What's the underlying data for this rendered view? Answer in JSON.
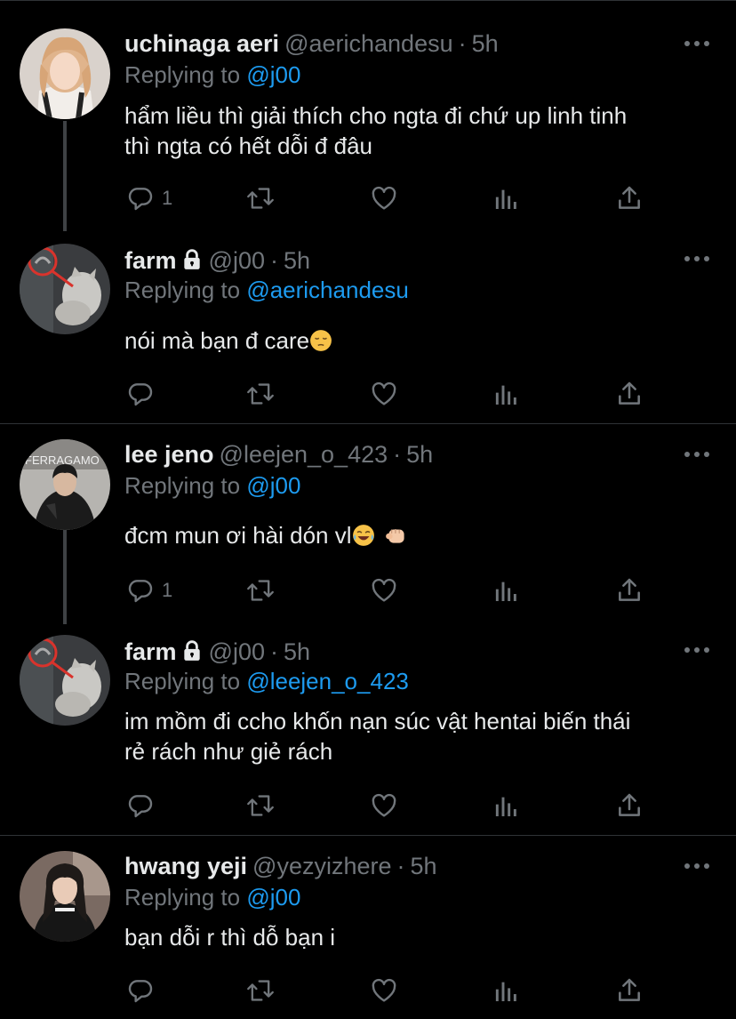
{
  "tweets": [
    {
      "name": "uchinaga aeri",
      "handle": "@aerichandesu",
      "dot": "·",
      "time": "5h",
      "locked": false,
      "replying_prefix": "Replying to ",
      "replying_to": "@j00",
      "text_lines": [
        "hẩm liều thì giải thích cho ngta đi chứ up linh tinh",
        "thì ngta có hết dỗi đ đâu"
      ],
      "reply_count": "1",
      "avatar": "woman-blonde-avatar"
    },
    {
      "name": "farm",
      "handle": "@j00",
      "dot": "·",
      "time": "5h",
      "locked": true,
      "replying_prefix": "Replying to ",
      "replying_to": "@aerichandesu",
      "text_lines": [
        "nói mà bạn đ care"
      ],
      "emoji": "pensive-face",
      "reply_count": "",
      "avatar": "cat-avatar"
    },
    {
      "name": "lee jeno",
      "handle": "@leejen_o_423",
      "dot": "·",
      "time": "5h",
      "locked": false,
      "replying_prefix": "Replying to ",
      "replying_to": "@j00",
      "text_lines": [
        "đcm mun ơi hài dón vl"
      ],
      "emoji": "laughing-tears-and-fist",
      "reply_count": "1",
      "avatar": "man-black-jacket-avatar",
      "avatar_text": "FERRAGAMO"
    },
    {
      "name": "farm",
      "handle": "@j00",
      "dot": "·",
      "time": "5h",
      "locked": true,
      "replying_prefix": "Replying to ",
      "replying_to": "@leejen_o_423",
      "text_lines": [
        "im mồm đi ccho khốn nạn súc vật hentai biến thái",
        "rẻ rách như giẻ rách"
      ],
      "reply_count": "",
      "avatar": "cat-avatar"
    },
    {
      "name": "hwang yeji",
      "handle": "@yezyizhere",
      "dot": "·",
      "time": "5h",
      "locked": false,
      "replying_prefix": "Replying to ",
      "replying_to": "@j00",
      "text_lines": [
        "bạn dỗi r thì dỗ bạn i"
      ],
      "reply_count": "",
      "avatar": "woman-dark-hair-avatar"
    }
  ],
  "icons": {
    "reply": "speech-bubble-icon",
    "retweet": "retweet-icon",
    "like": "heart-icon",
    "analytics": "bar-chart-icon",
    "share": "share-upload-icon",
    "more": "more-dots-icon",
    "lock": "lock-icon"
  },
  "colors": {
    "background": "#000000",
    "text": "#e7e9ea",
    "muted": "#71767b",
    "link": "#1d9bf0",
    "divider": "#2f3336",
    "thread_line": "#3e4144"
  }
}
